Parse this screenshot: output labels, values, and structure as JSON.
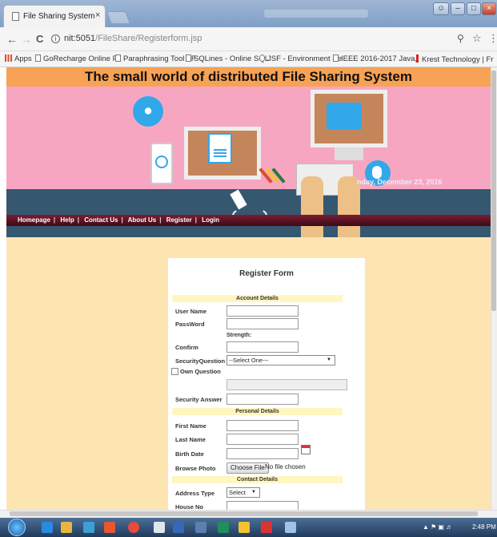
{
  "browser": {
    "tab_title": "File Sharing System",
    "tab_close": "×",
    "url_host": "nit:5051",
    "url_path": "/FileShare/Registerform.jsp",
    "back": "←",
    "forward": "→",
    "reload": "C",
    "bookmarks": [
      {
        "label": "Apps"
      },
      {
        "label": "GoRecharge Online P"
      },
      {
        "label": "Paraphrasing Tool - F"
      },
      {
        "label": "SQLines - Online SQL"
      },
      {
        "label": "JSF - Environment Se"
      },
      {
        "label": "IEEE 2016-2017 Java,I"
      },
      {
        "label": "Krest Technology | Fr"
      }
    ]
  },
  "site": {
    "title": "The small world of distributed File Sharing System",
    "date_text": "nday, December 23, 2016",
    "nav": [
      {
        "label": "Homepage"
      },
      {
        "label": "Help"
      },
      {
        "label": "Contact Us"
      },
      {
        "label": "About Us"
      },
      {
        "label": "Register"
      },
      {
        "label": "Login"
      }
    ]
  },
  "form": {
    "title": "Register Form",
    "sections": {
      "account": "Account Details",
      "personal": "Personal Details",
      "contact": "Contact Details"
    },
    "labels": {
      "user_name": "User Name",
      "password": "PassWord",
      "strength": "Strength:",
      "confirm": "Confirm",
      "security_question": "SecurityQuestion",
      "own_question": "Own Question",
      "security_answer": "Security Answer",
      "first_name": "First Name",
      "last_name": "Last Name",
      "birth_date": "Birth Date",
      "browse_photo": "Browse Photo",
      "address_type": "Address Type",
      "house_no": "House No"
    },
    "security_question_selected": "--Select One---",
    "address_type_selected": "Select",
    "choose_file": "Choose File",
    "no_file": "No file chosen"
  },
  "taskbar": {
    "clock": "2:48 PM"
  }
}
